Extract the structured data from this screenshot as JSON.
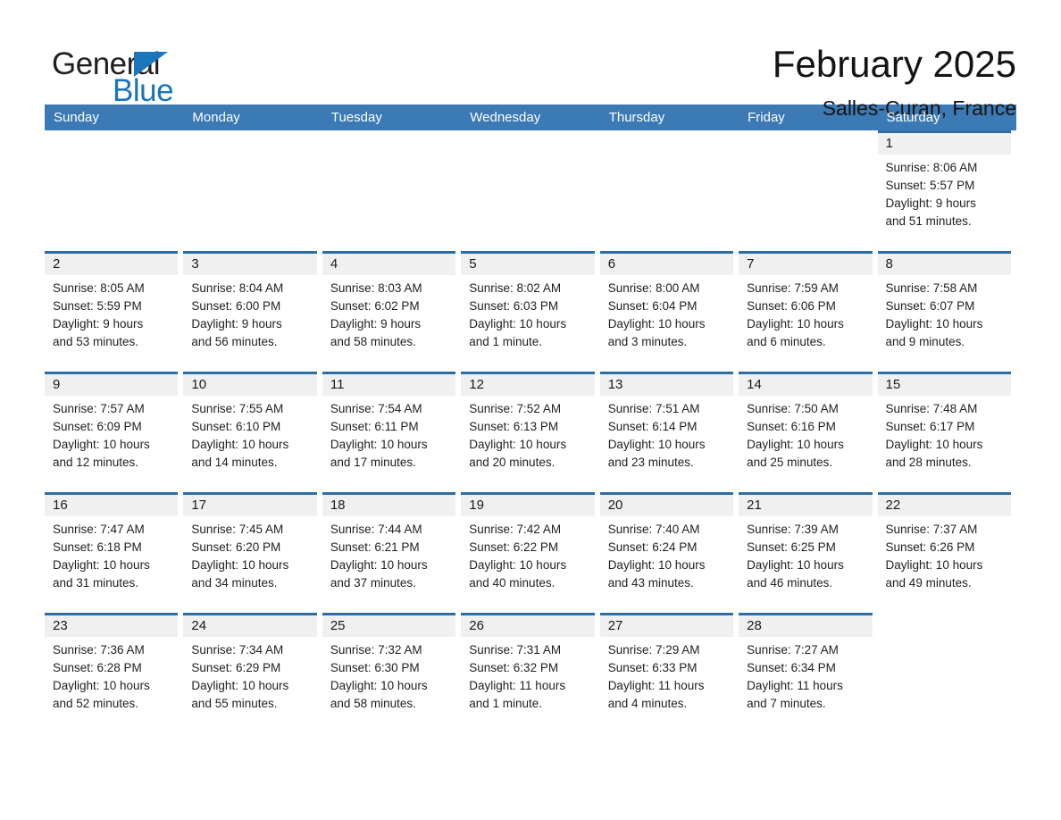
{
  "brand": {
    "name_part1": "General",
    "name_part2": "Blue",
    "triangle_color": "#1b75bb"
  },
  "header": {
    "title": "February 2025",
    "location": "Salles-Curan, France"
  },
  "theme": {
    "header_blue": "#3b7ab5",
    "row_rule_blue": "#2e6da4",
    "date_band_gray": "#f0f0f0"
  },
  "calendar": {
    "weekdays": [
      "Sunday",
      "Monday",
      "Tuesday",
      "Wednesday",
      "Thursday",
      "Friday",
      "Saturday"
    ],
    "weeks": [
      [
        {
          "empty": true
        },
        {
          "empty": true
        },
        {
          "empty": true
        },
        {
          "empty": true
        },
        {
          "empty": true
        },
        {
          "empty": true
        },
        {
          "empty": false,
          "date": "1",
          "sunrise": "Sunrise: 8:06 AM",
          "sunset": "Sunset: 5:57 PM",
          "daylight1": "Daylight: 9 hours",
          "daylight2": "and 51 minutes."
        }
      ],
      [
        {
          "empty": false,
          "date": "2",
          "sunrise": "Sunrise: 8:05 AM",
          "sunset": "Sunset: 5:59 PM",
          "daylight1": "Daylight: 9 hours",
          "daylight2": "and 53 minutes."
        },
        {
          "empty": false,
          "date": "3",
          "sunrise": "Sunrise: 8:04 AM",
          "sunset": "Sunset: 6:00 PM",
          "daylight1": "Daylight: 9 hours",
          "daylight2": "and 56 minutes."
        },
        {
          "empty": false,
          "date": "4",
          "sunrise": "Sunrise: 8:03 AM",
          "sunset": "Sunset: 6:02 PM",
          "daylight1": "Daylight: 9 hours",
          "daylight2": "and 58 minutes."
        },
        {
          "empty": false,
          "date": "5",
          "sunrise": "Sunrise: 8:02 AM",
          "sunset": "Sunset: 6:03 PM",
          "daylight1": "Daylight: 10 hours",
          "daylight2": "and 1 minute."
        },
        {
          "empty": false,
          "date": "6",
          "sunrise": "Sunrise: 8:00 AM",
          "sunset": "Sunset: 6:04 PM",
          "daylight1": "Daylight: 10 hours",
          "daylight2": "and 3 minutes."
        },
        {
          "empty": false,
          "date": "7",
          "sunrise": "Sunrise: 7:59 AM",
          "sunset": "Sunset: 6:06 PM",
          "daylight1": "Daylight: 10 hours",
          "daylight2": "and 6 minutes."
        },
        {
          "empty": false,
          "date": "8",
          "sunrise": "Sunrise: 7:58 AM",
          "sunset": "Sunset: 6:07 PM",
          "daylight1": "Daylight: 10 hours",
          "daylight2": "and 9 minutes."
        }
      ],
      [
        {
          "empty": false,
          "date": "9",
          "sunrise": "Sunrise: 7:57 AM",
          "sunset": "Sunset: 6:09 PM",
          "daylight1": "Daylight: 10 hours",
          "daylight2": "and 12 minutes."
        },
        {
          "empty": false,
          "date": "10",
          "sunrise": "Sunrise: 7:55 AM",
          "sunset": "Sunset: 6:10 PM",
          "daylight1": "Daylight: 10 hours",
          "daylight2": "and 14 minutes."
        },
        {
          "empty": false,
          "date": "11",
          "sunrise": "Sunrise: 7:54 AM",
          "sunset": "Sunset: 6:11 PM",
          "daylight1": "Daylight: 10 hours",
          "daylight2": "and 17 minutes."
        },
        {
          "empty": false,
          "date": "12",
          "sunrise": "Sunrise: 7:52 AM",
          "sunset": "Sunset: 6:13 PM",
          "daylight1": "Daylight: 10 hours",
          "daylight2": "and 20 minutes."
        },
        {
          "empty": false,
          "date": "13",
          "sunrise": "Sunrise: 7:51 AM",
          "sunset": "Sunset: 6:14 PM",
          "daylight1": "Daylight: 10 hours",
          "daylight2": "and 23 minutes."
        },
        {
          "empty": false,
          "date": "14",
          "sunrise": "Sunrise: 7:50 AM",
          "sunset": "Sunset: 6:16 PM",
          "daylight1": "Daylight: 10 hours",
          "daylight2": "and 25 minutes."
        },
        {
          "empty": false,
          "date": "15",
          "sunrise": "Sunrise: 7:48 AM",
          "sunset": "Sunset: 6:17 PM",
          "daylight1": "Daylight: 10 hours",
          "daylight2": "and 28 minutes."
        }
      ],
      [
        {
          "empty": false,
          "date": "16",
          "sunrise": "Sunrise: 7:47 AM",
          "sunset": "Sunset: 6:18 PM",
          "daylight1": "Daylight: 10 hours",
          "daylight2": "and 31 minutes."
        },
        {
          "empty": false,
          "date": "17",
          "sunrise": "Sunrise: 7:45 AM",
          "sunset": "Sunset: 6:20 PM",
          "daylight1": "Daylight: 10 hours",
          "daylight2": "and 34 minutes."
        },
        {
          "empty": false,
          "date": "18",
          "sunrise": "Sunrise: 7:44 AM",
          "sunset": "Sunset: 6:21 PM",
          "daylight1": "Daylight: 10 hours",
          "daylight2": "and 37 minutes."
        },
        {
          "empty": false,
          "date": "19",
          "sunrise": "Sunrise: 7:42 AM",
          "sunset": "Sunset: 6:22 PM",
          "daylight1": "Daylight: 10 hours",
          "daylight2": "and 40 minutes."
        },
        {
          "empty": false,
          "date": "20",
          "sunrise": "Sunrise: 7:40 AM",
          "sunset": "Sunset: 6:24 PM",
          "daylight1": "Daylight: 10 hours",
          "daylight2": "and 43 minutes."
        },
        {
          "empty": false,
          "date": "21",
          "sunrise": "Sunrise: 7:39 AM",
          "sunset": "Sunset: 6:25 PM",
          "daylight1": "Daylight: 10 hours",
          "daylight2": "and 46 minutes."
        },
        {
          "empty": false,
          "date": "22",
          "sunrise": "Sunrise: 7:37 AM",
          "sunset": "Sunset: 6:26 PM",
          "daylight1": "Daylight: 10 hours",
          "daylight2": "and 49 minutes."
        }
      ],
      [
        {
          "empty": false,
          "date": "23",
          "sunrise": "Sunrise: 7:36 AM",
          "sunset": "Sunset: 6:28 PM",
          "daylight1": "Daylight: 10 hours",
          "daylight2": "and 52 minutes."
        },
        {
          "empty": false,
          "date": "24",
          "sunrise": "Sunrise: 7:34 AM",
          "sunset": "Sunset: 6:29 PM",
          "daylight1": "Daylight: 10 hours",
          "daylight2": "and 55 minutes."
        },
        {
          "empty": false,
          "date": "25",
          "sunrise": "Sunrise: 7:32 AM",
          "sunset": "Sunset: 6:30 PM",
          "daylight1": "Daylight: 10 hours",
          "daylight2": "and 58 minutes."
        },
        {
          "empty": false,
          "date": "26",
          "sunrise": "Sunrise: 7:31 AM",
          "sunset": "Sunset: 6:32 PM",
          "daylight1": "Daylight: 11 hours",
          "daylight2": "and 1 minute."
        },
        {
          "empty": false,
          "date": "27",
          "sunrise": "Sunrise: 7:29 AM",
          "sunset": "Sunset: 6:33 PM",
          "daylight1": "Daylight: 11 hours",
          "daylight2": "and 4 minutes."
        },
        {
          "empty": false,
          "date": "28",
          "sunrise": "Sunrise: 7:27 AM",
          "sunset": "Sunset: 6:34 PM",
          "daylight1": "Daylight: 11 hours",
          "daylight2": "and 7 minutes."
        },
        {
          "empty": true
        }
      ]
    ]
  }
}
